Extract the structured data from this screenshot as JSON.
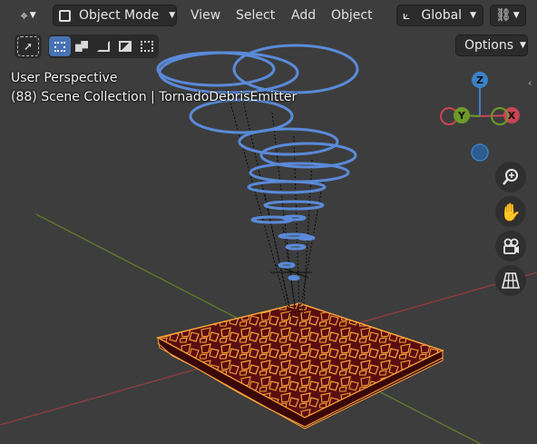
{
  "header": {
    "editor_type_icon": "transform-gizmo-icon",
    "mode_label": "Object Mode",
    "menus": [
      "View",
      "Select",
      "Add",
      "Object"
    ],
    "transform_orientation": "Global",
    "snap_icon": "snapping-link-icon",
    "options_label": "Options"
  },
  "toolbar": {
    "tools": [
      "select-cursor",
      "select-box",
      "select-extend",
      "select-subtract",
      "select-invert",
      "select-intersect"
    ]
  },
  "overlay": {
    "view_name": "User Perspective",
    "collection_info": "(88) Scene Collection | TornadoDebrisEmitter"
  },
  "gizmo": {
    "z_label": "Z",
    "y_label": "Y",
    "x_label": "X",
    "colors": {
      "x": "#c94453",
      "y": "#6d9b2a",
      "z": "#3b82c8"
    }
  },
  "nav_buttons": [
    "zoom-icon",
    "hand-pan-icon",
    "camera-icon",
    "grid-perspective-icon"
  ],
  "scene": {
    "ring_color": "#5a8ad8",
    "debris_color": "#ffa53a",
    "debris_fill": "#5a0e10",
    "grid_x_axis": "#8f3c40",
    "grid_y_axis": "#5e7a2a"
  }
}
